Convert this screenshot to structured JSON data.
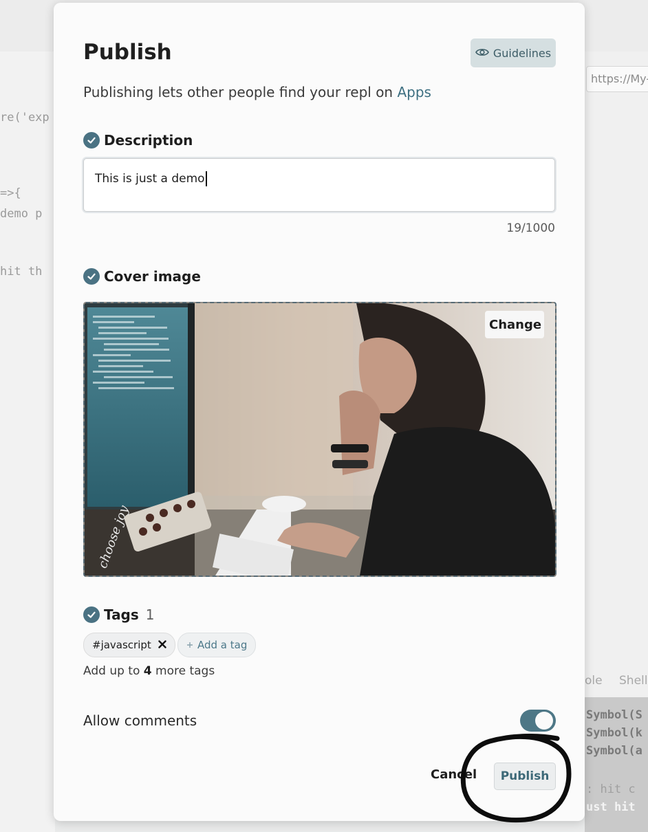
{
  "background": {
    "code_lines": [
      "re('exp",
      "=>{",
      " demo p",
      " hit th"
    ],
    "url_text": "https://My-",
    "tabs": [
      "ole",
      "Shell"
    ],
    "console_lines": [
      "Symbol(S",
      "Symbol(k",
      "Symbol(a",
      ": hit c",
      "ust hit"
    ]
  },
  "modal": {
    "title": "Publish",
    "guidelines_label": "Guidelines",
    "subtitle_prefix": "Publishing lets other people find your repl on ",
    "subtitle_link": "Apps",
    "description": {
      "heading": "Description",
      "value": "This is just a demo",
      "counter": "19/1000"
    },
    "cover_image": {
      "heading": "Cover image",
      "change_label": "Change",
      "watermark": "choose joy"
    },
    "tags": {
      "heading": "Tags",
      "count": "1",
      "items": [
        "#javascript"
      ],
      "add_label": "Add a tag",
      "hint_prefix": "Add up to ",
      "hint_number": "4",
      "hint_suffix": " more tags"
    },
    "allow_comments": {
      "label": "Allow comments",
      "enabled": true
    },
    "footer": {
      "cancel_label": "Cancel",
      "publish_label": "Publish"
    }
  },
  "colors": {
    "accent": "#4a7283",
    "link": "#3d6f81",
    "toggle_on": "#4d7786"
  }
}
